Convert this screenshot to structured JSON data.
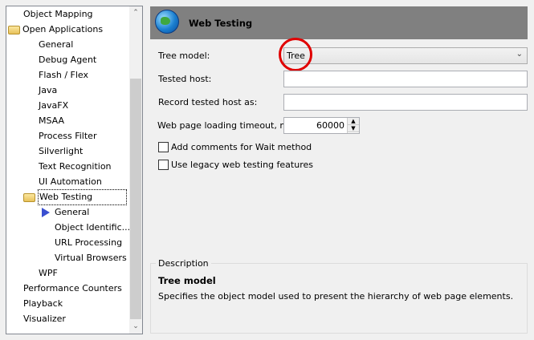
{
  "tree": {
    "items": [
      {
        "label": "Object Mapping",
        "level": 0
      },
      {
        "label": "Open Applications",
        "level": 0,
        "icon": "folder-open-icon"
      },
      {
        "label": "General",
        "level": 1
      },
      {
        "label": "Debug Agent",
        "level": 1
      },
      {
        "label": "Flash / Flex",
        "level": 1
      },
      {
        "label": "Java",
        "level": 1
      },
      {
        "label": "JavaFX",
        "level": 1
      },
      {
        "label": "MSAA",
        "level": 1
      },
      {
        "label": "Process Filter",
        "level": 1
      },
      {
        "label": "Silverlight",
        "level": 1
      },
      {
        "label": "Text Recognition",
        "level": 1
      },
      {
        "label": "UI Automation",
        "level": 1
      },
      {
        "label": "Web Testing",
        "level": 1,
        "icon": "folder-open-icon",
        "focused": true
      },
      {
        "label": "General",
        "level": 2,
        "icon": "arrow-right-icon",
        "selected": true
      },
      {
        "label": "Object Identific...",
        "level": 2
      },
      {
        "label": "URL Processing",
        "level": 2
      },
      {
        "label": "Virtual Browsers",
        "level": 2
      },
      {
        "label": "WPF",
        "level": 1
      },
      {
        "label": "Performance Counters",
        "level": 0
      },
      {
        "label": "Playback",
        "level": 0
      },
      {
        "label": "Visualizer",
        "level": 0
      }
    ]
  },
  "header": {
    "title": "Web Testing",
    "icon": "globe-icon"
  },
  "form": {
    "tree_model_label": "Tree model:",
    "tree_model_value": "Tree",
    "tested_host_label": "Tested host:",
    "tested_host_value": "",
    "record_host_label": "Record tested host as:",
    "record_host_value": "",
    "timeout_label": "Web page loading timeout, ms:",
    "timeout_value": "60000",
    "wait_comments_label": "Add comments for Wait method",
    "wait_comments_checked": false,
    "legacy_label": "Use legacy web testing features",
    "legacy_checked": false
  },
  "description": {
    "legend": "Description",
    "title": "Tree model",
    "text": "Specifies the object model used to present the hierarchy of web page elements."
  },
  "annotation_color": "#e00000"
}
